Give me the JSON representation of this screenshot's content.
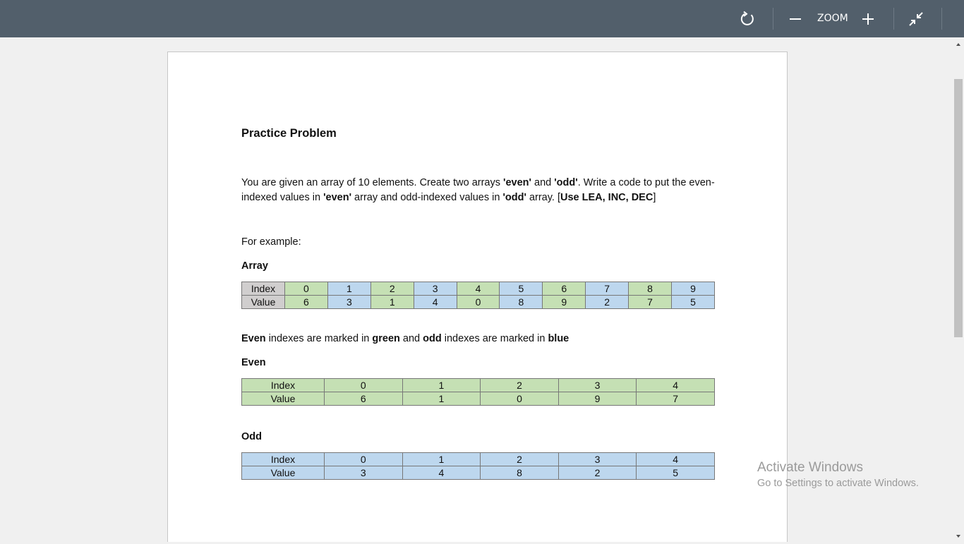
{
  "toolbar": {
    "zoom_label": "ZOOM",
    "icons": [
      "rotate-icon",
      "zoom-out-icon",
      "zoom-in-icon",
      "exit-fullscreen-icon"
    ]
  },
  "document": {
    "title": "Practice Problem",
    "para": {
      "t1": "You are given an array of 10 elements. Create two arrays ",
      "b1": "'even'",
      "t2": " and ",
      "b2": "'odd'",
      "t3": ". Write a code to put the even-indexed values in ",
      "b3": "'even'",
      "t4": " array and odd-indexed values in ",
      "b4": "'odd'",
      "t5": " array. [",
      "b5": "Use LEA, INC, DEC",
      "t6": "]"
    },
    "example_label": "For example:",
    "array_label": "Array",
    "array_table": {
      "row_labels": [
        "Index",
        "Value"
      ],
      "index": [
        "0",
        "1",
        "2",
        "3",
        "4",
        "5",
        "6",
        "7",
        "8",
        "9"
      ],
      "value": [
        "6",
        "3",
        "1",
        "4",
        "0",
        "8",
        "9",
        "2",
        "7",
        "5"
      ]
    },
    "note": {
      "b1": "Even",
      "t1": " indexes are marked in ",
      "b2": "green",
      "t2": " and ",
      "b3": "odd",
      "t3": " indexes are marked in ",
      "b4": "blue"
    },
    "even_label": "Even",
    "even_table": {
      "row_labels": [
        "Index",
        "Value"
      ],
      "index": [
        "0",
        "1",
        "2",
        "3",
        "4"
      ],
      "value": [
        "6",
        "1",
        "0",
        "9",
        "7"
      ]
    },
    "odd_label": "Odd",
    "odd_table": {
      "row_labels": [
        "Index",
        "Value"
      ],
      "index": [
        "0",
        "1",
        "2",
        "3",
        "4"
      ],
      "value": [
        "3",
        "4",
        "8",
        "2",
        "5"
      ]
    }
  },
  "watermark": {
    "line1": "Activate Windows",
    "line2": "Go to Settings to activate Windows."
  },
  "colors": {
    "toolbar": "#525f6b",
    "even_cell": "#c5e0b4",
    "odd_cell": "#bdd7ee",
    "header_cell": "#d0cece"
  }
}
